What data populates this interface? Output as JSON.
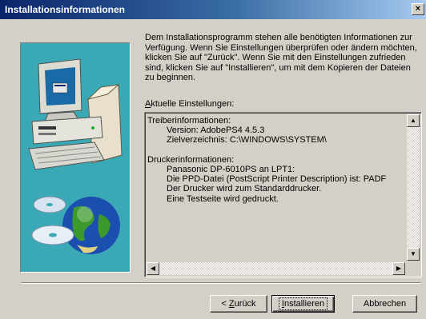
{
  "window": {
    "title": "Installationsinformationen",
    "close_glyph": "×"
  },
  "intro_text": "Dem Installationsprogramm stehen alle benötigten Informationen zur Verfügung. Wenn Sie Einstellungen überprüfen oder ändern möchten, klicken Sie auf \"Zurück\". Wenn Sie mit den Einstellungen zufrieden sind, klicken Sie auf \"Installieren\", um mit dem Kopieren der Dateien zu beginnen.",
  "settings_label": {
    "accel": "A",
    "rest": "ktuelle Einstellungen:"
  },
  "settings_lines": [
    {
      "text": "Treiberinformationen:",
      "indent": false
    },
    {
      "text": "Version: AdobePS4 4.5.3",
      "indent": true
    },
    {
      "text": "Zielverzeichnis: C:\\WINDOWS\\SYSTEM\\",
      "indent": true
    },
    {
      "text": "",
      "indent": false
    },
    {
      "text": "Druckerinformationen:",
      "indent": false
    },
    {
      "text": "Panasonic DP-6010PS an LPT1:",
      "indent": true
    },
    {
      "text": "Die PPD-Datei (PostScript Printer Description) ist: PADF",
      "indent": true
    },
    {
      "text": "Der Drucker wird zum Standarddrucker.",
      "indent": true
    },
    {
      "text": "Eine Testseite wird gedruckt.",
      "indent": true
    }
  ],
  "buttons": {
    "back": {
      "prefix": "< ",
      "accel": "Z",
      "rest": "urück"
    },
    "install": {
      "accel": "I",
      "rest": "nstallieren"
    },
    "cancel": {
      "label": "Abbrechen"
    }
  },
  "icons": {
    "art": "computer-with-cd-and-globe",
    "scroll_up": "scroll-up-arrow-icon",
    "scroll_down": "scroll-down-arrow-icon",
    "scroll_left": "scroll-left-arrow-icon",
    "scroll_right": "scroll-right-arrow-icon"
  },
  "colors": {
    "title_start": "#0a246a",
    "title_end": "#a6caf0",
    "art_bg": "#3aa9b5",
    "face": "#d4d0c8"
  }
}
